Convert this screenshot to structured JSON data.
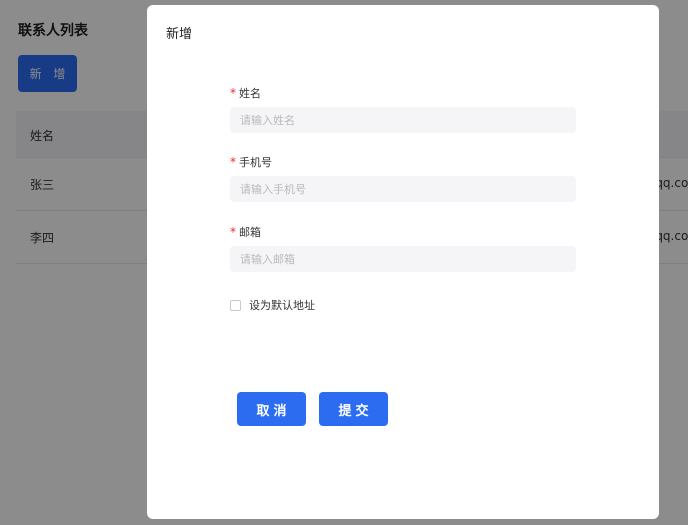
{
  "page": {
    "title": "联系人列表",
    "add_button": "新 增",
    "table": {
      "columns": [
        "姓名"
      ],
      "rows": [
        {
          "name": "张三",
          "email_partial": "qq.com"
        },
        {
          "name": "李四",
          "email_partial": "qq.com"
        }
      ]
    }
  },
  "modal": {
    "title": "新增",
    "fields": [
      {
        "label": "姓名",
        "required": true,
        "placeholder": "请输入姓名"
      },
      {
        "label": "手机号",
        "required": true,
        "placeholder": "请输入手机号"
      },
      {
        "label": "邮箱",
        "required": true,
        "placeholder": "请输入邮箱"
      }
    ],
    "required_mark": "*",
    "checkbox": {
      "label": "设为默认地址",
      "checked": false
    },
    "cancel_button": "取消",
    "submit_button": "提交"
  },
  "colors": {
    "primary": "#2b6cf0",
    "required": "#f5222d",
    "mask": "rgba(0,0,0,0.45)"
  }
}
